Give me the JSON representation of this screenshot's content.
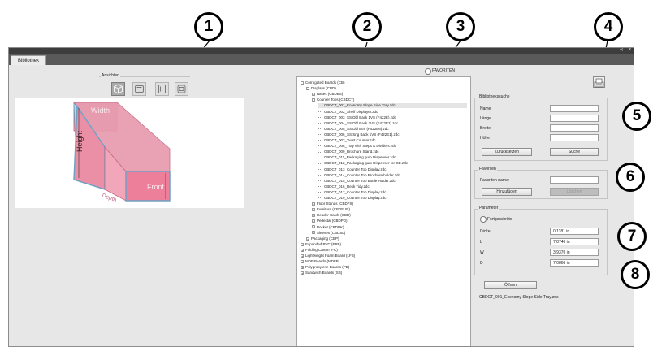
{
  "window": {
    "controls": [
      "«",
      "×"
    ],
    "tab_label": "Bibliothek"
  },
  "views": {
    "legend": "Ansichten",
    "buttons": [
      {
        "icon": "iso-view-icon",
        "active": true
      },
      {
        "icon": "front-view-icon",
        "active": false
      },
      {
        "icon": "side-view-icon",
        "active": false
      },
      {
        "icon": "top-view-icon",
        "active": false
      }
    ],
    "preview": {
      "width_label": "Width",
      "height_label": "Height",
      "front_label": "Front",
      "depth_label": "Depth"
    }
  },
  "favorites_radio": {
    "label": "FAVORITEN"
  },
  "tree": [
    {
      "label": "Corrugated Boards (CB)",
      "level": 0,
      "expand": "-"
    },
    {
      "label": "Displays (CBD)",
      "level": 1,
      "expand": "-"
    },
    {
      "label": "Bases (CBDBS)",
      "level": 2,
      "expand": "+"
    },
    {
      "label": "Counter Tops (CBDCT)",
      "level": 2,
      "expand": "-"
    },
    {
      "label": "CBDCT_001_Economy Slope Side Tray.zdc",
      "level": 3,
      "selected": true
    },
    {
      "label": "CBDCT_002_Shelf Displayer.zdc",
      "level": 3
    },
    {
      "label": "CBDCT_003_SS Dbl Back 1VS (F422E).zdc",
      "level": 3
    },
    {
      "label": "CBDCT_004_SS Dbl Back 2VS (F422E2).zdc",
      "level": 3
    },
    {
      "label": "CBDCT_005_SS Dbl Btm (F422E6).zdc",
      "level": 3
    },
    {
      "label": "CBDCT_006_SS Sng Back 1VS (F422E1).zdc",
      "level": 3
    },
    {
      "label": "CBDCT_007_Twist Counter.zdc",
      "level": 3
    },
    {
      "label": "CBDCT_008_Tray with Steps & Dividers.zdc",
      "level": 3
    },
    {
      "label": "CBDCT_009_Brochure Stand.zdc",
      "level": 3
    },
    {
      "label": "CBDCT_011_Packaging gum Dispenser.zdc",
      "level": 3
    },
    {
      "label": "CBDCT_012_Packaging gum Dispenser for CD.zdc",
      "level": 3
    },
    {
      "label": "CBDCT_013_Counter Top Display.zdc",
      "level": 3
    },
    {
      "label": "CBDCT_014_Counter Top Brochure holder.zdc",
      "level": 3
    },
    {
      "label": "CBDCT_015_Counter Top Bottle Holder.zdc",
      "level": 3
    },
    {
      "label": "CBDCT_016_Desk Tidy.zdc",
      "level": 3
    },
    {
      "label": "CBDCT_017_Counter Top Display.zdc",
      "level": 3
    },
    {
      "label": "CBDCT_019_Counter Top Display.zdc",
      "level": 3
    },
    {
      "label": "Floor Stands (CBDFS)",
      "level": 2,
      "expand": "+"
    },
    {
      "label": "Furniture (CBDFUR)",
      "level": 2,
      "expand": "+"
    },
    {
      "label": "Header Cards (CBD)",
      "level": 2,
      "expand": "+"
    },
    {
      "label": "Pedestal (CBDPD)",
      "level": 2,
      "expand": "+"
    },
    {
      "label": "Pocket (CBDPK)",
      "level": 2,
      "expand": "+"
    },
    {
      "label": "Sleeves (CBDSL)",
      "level": 2,
      "expand": "+"
    },
    {
      "label": "Packaging (CBP)",
      "level": 1,
      "expand": "+"
    },
    {
      "label": "Expanded PVC (EPB)",
      "level": 0,
      "expand": "+"
    },
    {
      "label": "Folding Carton (FC)",
      "level": 0,
      "expand": "+"
    },
    {
      "label": "Lightweight Foam Board (LFB)",
      "level": 0,
      "expand": "+"
    },
    {
      "label": "MDF Boards (MDFB)",
      "level": 0,
      "expand": "+"
    },
    {
      "label": "Polypropylene Boards (PB)",
      "level": 0,
      "expand": "+"
    },
    {
      "label": "Sandwich Boards (SB)",
      "level": 0,
      "expand": "+"
    }
  ],
  "search": {
    "legend": "Bibliothekssuche",
    "fields": [
      {
        "label": "Name",
        "value": ""
      },
      {
        "label": "Länge",
        "value": ""
      },
      {
        "label": "Breite",
        "value": ""
      },
      {
        "label": "Höhe",
        "value": ""
      }
    ],
    "reset_button": "Zurücksetzen",
    "search_button": "Suche"
  },
  "favorites": {
    "legend": "Favoriten",
    "name_label": "Favoriten name:",
    "name_value": "",
    "add_button": "Hinzufügen",
    "remove_button": "Löschen"
  },
  "parameters": {
    "legend": "Parameter",
    "advanced_label": "Fortgeschritte",
    "fields": [
      {
        "label": "Dicke",
        "value": "0.1181 in"
      },
      {
        "label": "L",
        "value": "7.8740 in"
      },
      {
        "label": "W",
        "value": "3.9370 in"
      },
      {
        "label": "D",
        "value": "7.0866 in"
      }
    ]
  },
  "open_button": "Öffnen",
  "selected_file": "CBDCT_001_Economy Slope Side Tray.zdc",
  "callouts": [
    "1",
    "2",
    "3",
    "4",
    "5",
    "6",
    "7",
    "8"
  ]
}
